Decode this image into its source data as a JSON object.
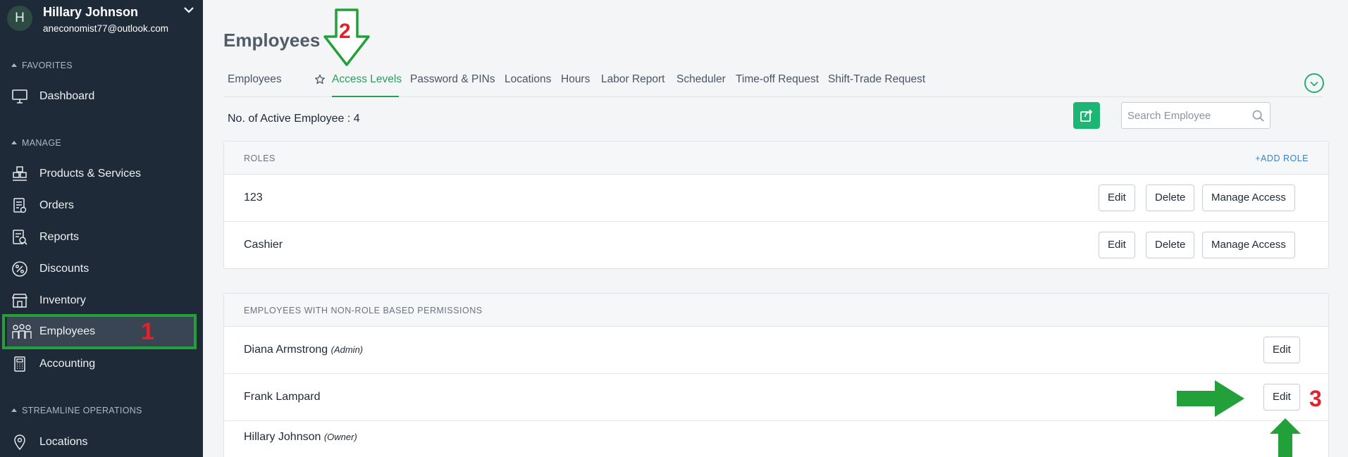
{
  "user": {
    "initial": "H",
    "name": "Hillary Johnson",
    "email": "aneconomist77@outlook.com"
  },
  "sidebar": {
    "sections": [
      {
        "label": "FAVORITES"
      },
      {
        "label": "MANAGE"
      },
      {
        "label": "STREAMLINE OPERATIONS"
      }
    ],
    "items": [
      {
        "label": "Dashboard",
        "icon": "monitor-icon"
      },
      {
        "label": "Products & Services",
        "icon": "boxes-icon"
      },
      {
        "label": "Orders",
        "icon": "orders-icon"
      },
      {
        "label": "Reports",
        "icon": "reports-icon"
      },
      {
        "label": "Discounts",
        "icon": "percent-icon"
      },
      {
        "label": "Inventory",
        "icon": "store-icon"
      },
      {
        "label": "Employees",
        "icon": "people-icon"
      },
      {
        "label": "Accounting",
        "icon": "calculator-icon"
      },
      {
        "label": "Locations",
        "icon": "map-pin-icon"
      }
    ]
  },
  "annotations": {
    "step1": "1",
    "step2": "2",
    "step3": "3"
  },
  "page": {
    "title": "Employees"
  },
  "tabs": [
    {
      "label": "Employees"
    },
    {
      "label": "Access Levels"
    },
    {
      "label": "Password & PINs"
    },
    {
      "label": "Locations"
    },
    {
      "label": "Hours"
    },
    {
      "label": "Labor Report"
    },
    {
      "label": "Scheduler"
    },
    {
      "label": "Time-off Request"
    },
    {
      "label": "Shift-Trade Request"
    }
  ],
  "toolbar": {
    "count_label": "No. of Active Employee : 4",
    "search_placeholder": "Search Employee"
  },
  "roles": {
    "header": "ROLES",
    "add_label": "+ADD ROLE",
    "rows": [
      {
        "name": "123",
        "edit": "Edit",
        "delete": "Delete",
        "manage": "Manage Access"
      },
      {
        "name": "Cashier",
        "edit": "Edit",
        "delete": "Delete",
        "manage": "Manage Access"
      }
    ]
  },
  "nonrole": {
    "header": "EMPLOYEES WITH NON-ROLE BASED PERMISSIONS",
    "rows": [
      {
        "name": "Diana Armstrong",
        "tag": "(Admin)",
        "edit": "Edit"
      },
      {
        "name": "Frank Lampard",
        "tag": "",
        "edit": "Edit"
      },
      {
        "name": "Hillary Johnson",
        "tag": "(Owner)",
        "edit": ""
      }
    ]
  },
  "colors": {
    "sidebar_bg": "#1f2a38",
    "accent_green": "#2a9d5e",
    "highlight_green": "#22a13b",
    "annotation_red": "#e0232b",
    "link_blue": "#3b82c4"
  }
}
